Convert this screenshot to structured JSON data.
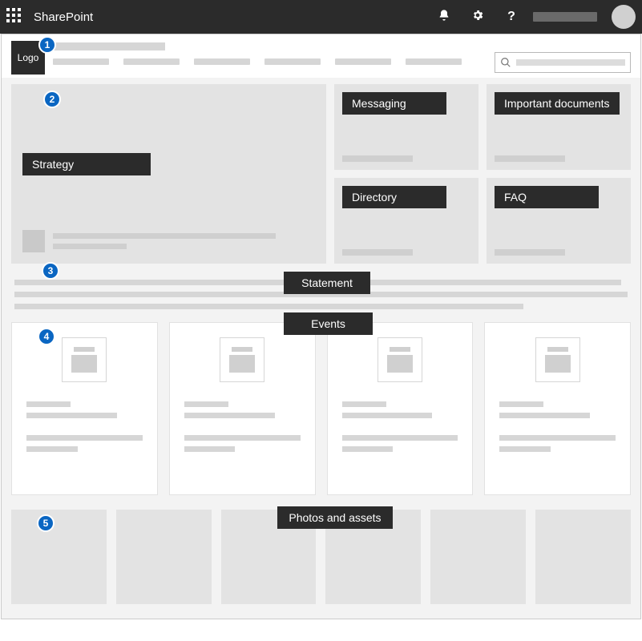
{
  "suite": {
    "app_name": "SharePoint",
    "notifications_icon": "bell-icon",
    "settings_icon": "gear-icon",
    "help_icon": "help-icon"
  },
  "header": {
    "logo_text": "Logo",
    "search_placeholder": "Search"
  },
  "labels": {
    "strategy": "Strategy",
    "messaging": "Messaging",
    "important_docs": "Important documents",
    "directory": "Directory",
    "faq": "FAQ",
    "statement": "Statement",
    "events": "Events",
    "photos": "Photos and assets"
  },
  "callouts": {
    "c1": "1",
    "c2": "2",
    "c3": "3",
    "c4": "4",
    "c5": "5"
  }
}
